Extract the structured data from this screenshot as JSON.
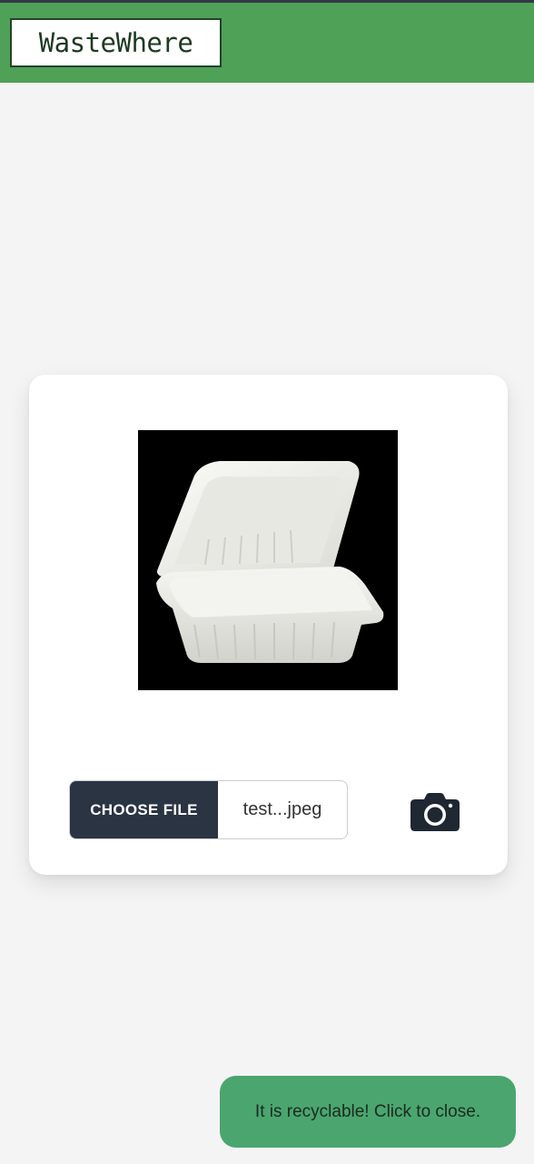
{
  "app": {
    "title": "WasteWhere"
  },
  "upload": {
    "choose_label": "CHOOSE FILE",
    "file_name": "test...jpeg",
    "camera_icon": "camera-icon",
    "preview_subject": "white clamshell takeout container"
  },
  "toast": {
    "message": "It is recyclable! Click to close."
  },
  "colors": {
    "header": "#50a158",
    "button": "#2b3442",
    "toast": "#4aa66e",
    "background": "#f4f4f4"
  }
}
